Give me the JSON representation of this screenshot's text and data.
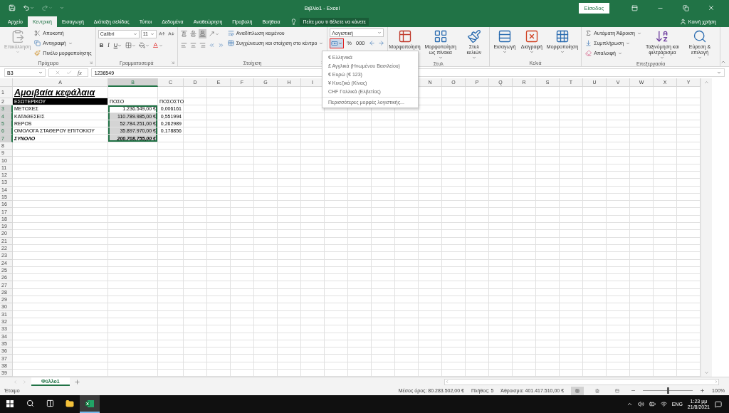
{
  "title_bar": {
    "title": "Βιβλίο1 - Excel",
    "sign_in": "Είσοδος"
  },
  "tabs": [
    {
      "label": "Αρχείο",
      "selected": false
    },
    {
      "label": "Κεντρική",
      "selected": true
    },
    {
      "label": "Εισαγωγή",
      "selected": false
    },
    {
      "label": "Διάταξη σελίδας",
      "selected": false
    },
    {
      "label": "Τύποι",
      "selected": false
    },
    {
      "label": "Δεδομένα",
      "selected": false
    },
    {
      "label": "Αναθεώρηση",
      "selected": false
    },
    {
      "label": "Προβολή",
      "selected": false
    },
    {
      "label": "Βοήθεια",
      "selected": false
    }
  ],
  "tell_me": "Πείτε μου τι θέλετε να κάνετε",
  "share": "Κοινή χρήση",
  "ribbon": {
    "clipboard": {
      "label": "Πρόχειρο",
      "paste": {
        "label": "Επικόλληση",
        "disabled": true
      },
      "cut": "Αποκοπή",
      "copy": "Αντιγραφή",
      "format_painter": "Πινέλο μορφοποίησης"
    },
    "font": {
      "label": "Γραμματοσειρά",
      "font_name": "Calibri",
      "font_size": "11",
      "bold": "B",
      "italic": "I",
      "underline": "U"
    },
    "alignment": {
      "label": "Στοίχιση",
      "vertical": [
        {
          "selected": false
        },
        {
          "selected": false
        },
        {
          "selected": true
        }
      ],
      "wrap_text": "Αναδίπλωση κειμένου",
      "merge": "Συγχώνευση και στοίχιση στο κέντρο"
    },
    "number": {
      "format": "Λογιστική",
      "accounting_menu_open": true,
      "percent": "%",
      "thousands": "000"
    },
    "styles": {
      "label": "Στυλ",
      "conditional": "Μορφοποίηση",
      "as_table": "Μορφοποίηση ως πίνακα",
      "cell_styles": "Στυλ κελιών"
    },
    "cells": {
      "label": "Κελιά",
      "insert": "Εισαγωγή",
      "delete": "Διαγραφή",
      "format": "Μορφοποίηση"
    },
    "editing": {
      "label": "Επεξεργασία",
      "autosum": "Αυτόματη Άθροιση",
      "fill": "Συμπλήρωση",
      "clear": "Απαλοιφή",
      "sort_filter": "Ταξινόμηση και φιλτράρισμα",
      "find": "Εύρεση & επιλογή"
    }
  },
  "number_menu": {
    "items": [
      {
        "kind": "currency",
        "label": "€ Ελληνικά"
      },
      {
        "kind": "currency",
        "label": "£ Αγγλικά (Ηνωμένου Βασιλείου)"
      },
      {
        "kind": "currency",
        "label": "€ Ευρώ (€ 123)"
      },
      {
        "kind": "currency",
        "label": "¥ Κινεζικά (Κίνας)"
      },
      {
        "kind": "currency",
        "label": "CHF Γαλλικά (Ελβετίας)"
      },
      {
        "kind": "more",
        "label": "Περισσότερες μορφές λογιστικής..."
      }
    ]
  },
  "formula_bar": {
    "name_box": "B3",
    "function_label": "fx",
    "value": "1236549"
  },
  "columns": [
    {
      "label": "A",
      "selected": false
    },
    {
      "label": "B",
      "selected": true
    },
    {
      "label": "C",
      "selected": false
    },
    {
      "label": "D",
      "selected": false
    },
    {
      "label": "E",
      "selected": false
    },
    {
      "label": "F",
      "selected": false
    },
    {
      "label": "G",
      "selected": false
    },
    {
      "label": "H",
      "selected": false
    },
    {
      "label": "I",
      "selected": false
    },
    null,
    null,
    null,
    null,
    {
      "label": "N",
      "selected": false
    },
    {
      "label": "O",
      "selected": false
    },
    {
      "label": "P",
      "selected": false
    },
    {
      "label": "Q",
      "selected": false
    },
    {
      "label": "R",
      "selected": false
    },
    {
      "label": "S",
      "selected": false
    },
    {
      "label": "T",
      "selected": false
    },
    {
      "label": "U",
      "selected": false
    },
    {
      "label": "V",
      "selected": false
    },
    {
      "label": "W",
      "selected": false
    },
    {
      "label": "X",
      "selected": false
    },
    {
      "label": "Y",
      "selected": false
    }
  ],
  "rows": [
    {
      "number": "1",
      "kind": "title",
      "selected": false,
      "cells": [
        {
          "text": "Αμοιβαία κεφάλαια",
          "active": false
        }
      ]
    },
    {
      "number": "2",
      "kind": "header",
      "selected": false,
      "cells": [
        {
          "text": "ΕΣΩΤΕΡΙΚΟΥ",
          "active": false
        },
        {
          "text": "ΠΟΣΟ",
          "active": false
        },
        {
          "text": "ΠΟΣΟΣΤΟ",
          "active": false
        }
      ]
    },
    {
      "number": "3",
      "kind": "data",
      "selected": true,
      "cells": [
        {
          "text": "ΜΕΤΟΧΕΣ",
          "active": false
        },
        {
          "text": "1.236.549,00 €",
          "active": true
        },
        {
          "text": "0,006161",
          "active": false
        }
      ]
    },
    {
      "number": "4",
      "kind": "data",
      "selected": true,
      "cells": [
        {
          "text": "ΚΑΤΑΘΕΣΕΙΣ",
          "active": false
        },
        {
          "text": "110.789.985,00 €",
          "active": false
        },
        {
          "text": "0,551994",
          "active": false
        }
      ]
    },
    {
      "number": "5",
      "kind": "data",
      "selected": true,
      "cells": [
        {
          "text": "REPOS",
          "active": false
        },
        {
          "text": "52.784.251,00 €",
          "active": false
        },
        {
          "text": "0,262989",
          "active": false
        }
      ]
    },
    {
      "number": "6",
      "kind": "data",
      "selected": true,
      "cells": [
        {
          "text": "ΟΜΟΛΟΓΑ ΣΤΑΘΕΡΟΥ ΕΠΙΤΟΚΙΟΥ",
          "active": false
        },
        {
          "text": "35.897.970,00 €",
          "active": false
        },
        {
          "text": "0,178856",
          "active": false
        }
      ]
    },
    {
      "number": "7",
      "kind": "total",
      "selected": true,
      "cells": [
        {
          "text": "ΣΥΝΟΛΟ",
          "active": false
        },
        {
          "text": "200.708.755,00 €",
          "active": false
        }
      ]
    },
    {
      "number": "8",
      "kind": "empty",
      "selected": false
    },
    {
      "number": "9",
      "kind": "empty",
      "selected": false
    },
    {
      "number": "10",
      "kind": "empty",
      "selected": false
    },
    {
      "number": "11",
      "kind": "empty",
      "selected": false
    },
    {
      "number": "12",
      "kind": "empty",
      "selected": false
    },
    {
      "number": "13",
      "kind": "empty",
      "selected": false
    },
    {
      "number": "14",
      "kind": "empty",
      "selected": false
    },
    {
      "number": "15",
      "kind": "empty",
      "selected": false
    },
    {
      "number": "16",
      "kind": "empty",
      "selected": false
    },
    {
      "number": "17",
      "kind": "empty",
      "selected": false
    },
    {
      "number": "18",
      "kind": "empty",
      "selected": false
    },
    {
      "number": "19",
      "kind": "empty",
      "selected": false
    },
    {
      "number": "20",
      "kind": "empty",
      "selected": false
    },
    {
      "number": "21",
      "kind": "empty",
      "selected": false
    },
    {
      "number": "22",
      "kind": "empty",
      "selected": false
    },
    {
      "number": "23",
      "kind": "empty",
      "selected": false
    },
    {
      "number": "24",
      "kind": "empty",
      "selected": false
    },
    {
      "number": "25",
      "kind": "empty",
      "selected": false
    },
    {
      "number": "26",
      "kind": "empty",
      "selected": false
    },
    {
      "number": "27",
      "kind": "empty",
      "selected": false
    },
    {
      "number": "28",
      "kind": "empty",
      "selected": false
    },
    {
      "number": "29",
      "kind": "empty",
      "selected": false
    },
    {
      "number": "30",
      "kind": "empty",
      "selected": false
    },
    {
      "number": "31",
      "kind": "empty",
      "selected": false
    },
    {
      "number": "32",
      "kind": "empty",
      "selected": false
    },
    {
      "number": "33",
      "kind": "empty",
      "selected": false
    },
    {
      "number": "34",
      "kind": "empty",
      "selected": false
    },
    {
      "number": "35",
      "kind": "empty",
      "selected": false
    },
    {
      "number": "36",
      "kind": "empty",
      "selected": false
    },
    {
      "number": "37",
      "kind": "empty",
      "selected": false
    },
    {
      "number": "38",
      "kind": "empty",
      "selected": false
    },
    {
      "number": "39",
      "kind": "empty",
      "selected": false
    }
  ],
  "sheet_tabs": [
    {
      "label": "Φύλλο1",
      "selected": true
    }
  ],
  "status_bar": {
    "ready": "Έτοιμο",
    "average": "Μέσος όρος: 80.283.502,00 €",
    "count": "Πλήθος: 5",
    "sum": "Άθροισμα: 401.417.510,00 €",
    "views": [
      {
        "kind": "normal",
        "selected": true
      },
      {
        "kind": "page-layout",
        "selected": false
      },
      {
        "kind": "page-break",
        "selected": false
      }
    ],
    "zoom": {
      "level": 0.5,
      "reading": "100%"
    }
  },
  "taskbar": {
    "apps": [
      {
        "kind": "start",
        "active": false
      },
      {
        "kind": "search",
        "active": false
      },
      {
        "kind": "task-view",
        "active": false
      },
      {
        "kind": "explorer",
        "active": false
      },
      {
        "kind": "excel",
        "active": true
      }
    ],
    "language": "ENG",
    "time": "1:23 μμ",
    "date": "21/8/2021"
  }
}
